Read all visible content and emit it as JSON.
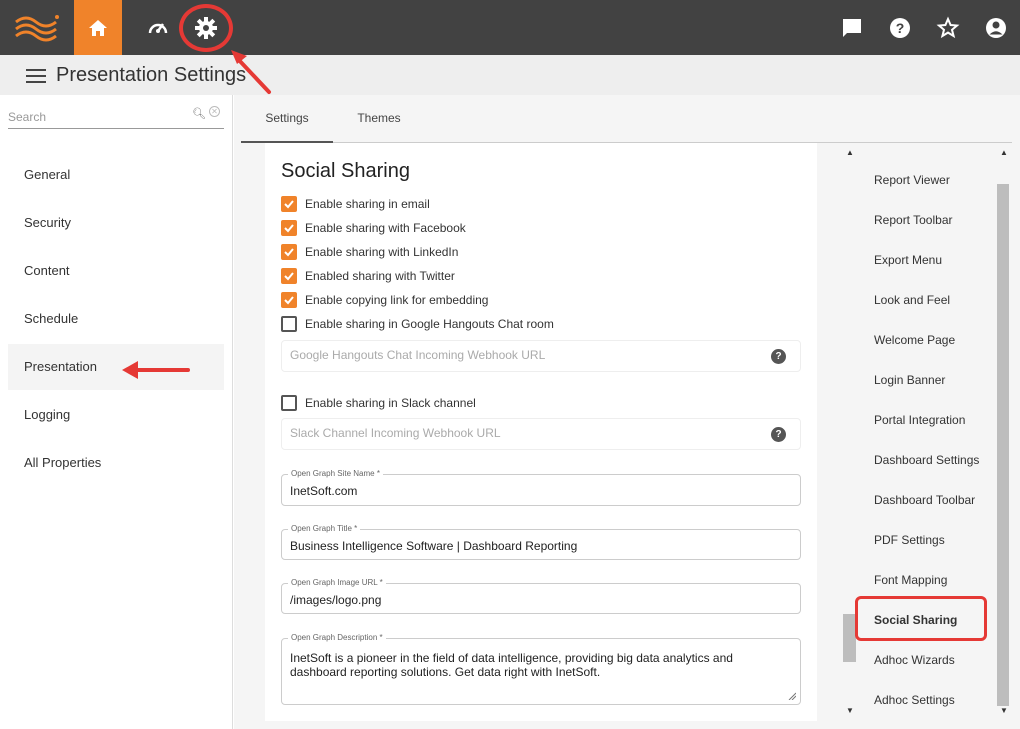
{
  "header": {
    "page_title": "Presentation Settings",
    "accent_color": "#f0832a",
    "bar_color": "#424242",
    "highlight_color": "#e53935"
  },
  "sidebar": {
    "search_placeholder": "Search",
    "items": [
      {
        "label": "General"
      },
      {
        "label": "Security"
      },
      {
        "label": "Content"
      },
      {
        "label": "Schedule"
      },
      {
        "label": "Presentation"
      },
      {
        "label": "Logging"
      },
      {
        "label": "All Properties"
      }
    ]
  },
  "tabs": [
    {
      "label": "Settings"
    },
    {
      "label": "Themes"
    }
  ],
  "social": {
    "title": "Social Sharing",
    "checkboxes": [
      {
        "label": "Enable sharing in email",
        "checked": true
      },
      {
        "label": "Enable sharing with Facebook",
        "checked": true
      },
      {
        "label": "Enable sharing with LinkedIn",
        "checked": true
      },
      {
        "label": "Enabled sharing with Twitter",
        "checked": true
      },
      {
        "label": "Enable copying link for embedding",
        "checked": true
      },
      {
        "label": "Enable sharing in Google Hangouts Chat room",
        "checked": false
      }
    ],
    "hangouts_placeholder": "Google Hangouts Chat Incoming Webhook URL",
    "slack_label": "Enable sharing in Slack channel",
    "slack_checked": false,
    "slack_placeholder": "Slack Channel Incoming Webhook URL",
    "site_name_label": "Open Graph Site Name *",
    "site_name_value": "InetSoft.com",
    "og_title_label": "Open Graph Title *",
    "og_title_value": "Business Intelligence Software | Dashboard Reporting",
    "image_url_label": "Open Graph Image URL *",
    "image_url_value": "/images/logo.png",
    "description_label": "Open Graph Description *",
    "description_value": "InetSoft is a pioneer in the field of data intelligence, providing big data analytics and dashboard reporting solutions. Get data right with InetSoft."
  },
  "rightnav": {
    "items": [
      {
        "label": "Report Viewer"
      },
      {
        "label": "Report Toolbar"
      },
      {
        "label": "Export Menu"
      },
      {
        "label": "Look and Feel"
      },
      {
        "label": "Welcome Page"
      },
      {
        "label": "Login Banner"
      },
      {
        "label": "Portal Integration"
      },
      {
        "label": "Dashboard Settings"
      },
      {
        "label": "Dashboard Toolbar"
      },
      {
        "label": "PDF Settings"
      },
      {
        "label": "Font Mapping"
      },
      {
        "label": "Social Sharing"
      },
      {
        "label": "Adhoc Wizards"
      },
      {
        "label": "Adhoc Settings"
      }
    ]
  }
}
